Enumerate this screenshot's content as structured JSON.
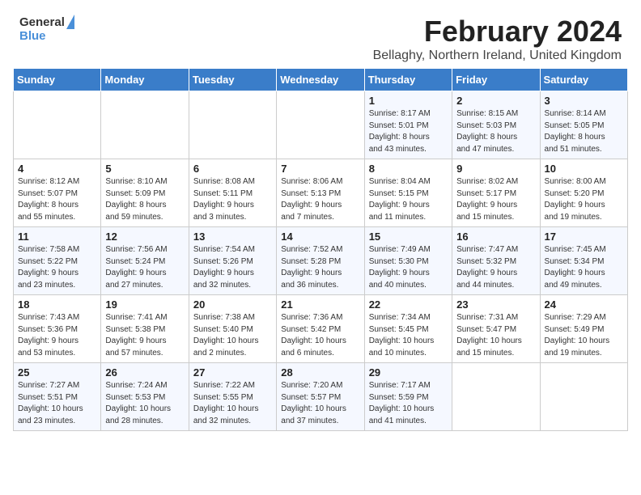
{
  "header": {
    "logo_general": "General",
    "logo_blue": "Blue",
    "title": "February 2024",
    "subtitle": "Bellaghy, Northern Ireland, United Kingdom"
  },
  "weekdays": [
    "Sunday",
    "Monday",
    "Tuesday",
    "Wednesday",
    "Thursday",
    "Friday",
    "Saturday"
  ],
  "weeks": [
    [
      {
        "day": "",
        "info": ""
      },
      {
        "day": "",
        "info": ""
      },
      {
        "day": "",
        "info": ""
      },
      {
        "day": "",
        "info": ""
      },
      {
        "day": "1",
        "info": "Sunrise: 8:17 AM\nSunset: 5:01 PM\nDaylight: 8 hours\nand 43 minutes."
      },
      {
        "day": "2",
        "info": "Sunrise: 8:15 AM\nSunset: 5:03 PM\nDaylight: 8 hours\nand 47 minutes."
      },
      {
        "day": "3",
        "info": "Sunrise: 8:14 AM\nSunset: 5:05 PM\nDaylight: 8 hours\nand 51 minutes."
      }
    ],
    [
      {
        "day": "4",
        "info": "Sunrise: 8:12 AM\nSunset: 5:07 PM\nDaylight: 8 hours\nand 55 minutes."
      },
      {
        "day": "5",
        "info": "Sunrise: 8:10 AM\nSunset: 5:09 PM\nDaylight: 8 hours\nand 59 minutes."
      },
      {
        "day": "6",
        "info": "Sunrise: 8:08 AM\nSunset: 5:11 PM\nDaylight: 9 hours\nand 3 minutes."
      },
      {
        "day": "7",
        "info": "Sunrise: 8:06 AM\nSunset: 5:13 PM\nDaylight: 9 hours\nand 7 minutes."
      },
      {
        "day": "8",
        "info": "Sunrise: 8:04 AM\nSunset: 5:15 PM\nDaylight: 9 hours\nand 11 minutes."
      },
      {
        "day": "9",
        "info": "Sunrise: 8:02 AM\nSunset: 5:17 PM\nDaylight: 9 hours\nand 15 minutes."
      },
      {
        "day": "10",
        "info": "Sunrise: 8:00 AM\nSunset: 5:20 PM\nDaylight: 9 hours\nand 19 minutes."
      }
    ],
    [
      {
        "day": "11",
        "info": "Sunrise: 7:58 AM\nSunset: 5:22 PM\nDaylight: 9 hours\nand 23 minutes."
      },
      {
        "day": "12",
        "info": "Sunrise: 7:56 AM\nSunset: 5:24 PM\nDaylight: 9 hours\nand 27 minutes."
      },
      {
        "day": "13",
        "info": "Sunrise: 7:54 AM\nSunset: 5:26 PM\nDaylight: 9 hours\nand 32 minutes."
      },
      {
        "day": "14",
        "info": "Sunrise: 7:52 AM\nSunset: 5:28 PM\nDaylight: 9 hours\nand 36 minutes."
      },
      {
        "day": "15",
        "info": "Sunrise: 7:49 AM\nSunset: 5:30 PM\nDaylight: 9 hours\nand 40 minutes."
      },
      {
        "day": "16",
        "info": "Sunrise: 7:47 AM\nSunset: 5:32 PM\nDaylight: 9 hours\nand 44 minutes."
      },
      {
        "day": "17",
        "info": "Sunrise: 7:45 AM\nSunset: 5:34 PM\nDaylight: 9 hours\nand 49 minutes."
      }
    ],
    [
      {
        "day": "18",
        "info": "Sunrise: 7:43 AM\nSunset: 5:36 PM\nDaylight: 9 hours\nand 53 minutes."
      },
      {
        "day": "19",
        "info": "Sunrise: 7:41 AM\nSunset: 5:38 PM\nDaylight: 9 hours\nand 57 minutes."
      },
      {
        "day": "20",
        "info": "Sunrise: 7:38 AM\nSunset: 5:40 PM\nDaylight: 10 hours\nand 2 minutes."
      },
      {
        "day": "21",
        "info": "Sunrise: 7:36 AM\nSunset: 5:42 PM\nDaylight: 10 hours\nand 6 minutes."
      },
      {
        "day": "22",
        "info": "Sunrise: 7:34 AM\nSunset: 5:45 PM\nDaylight: 10 hours\nand 10 minutes."
      },
      {
        "day": "23",
        "info": "Sunrise: 7:31 AM\nSunset: 5:47 PM\nDaylight: 10 hours\nand 15 minutes."
      },
      {
        "day": "24",
        "info": "Sunrise: 7:29 AM\nSunset: 5:49 PM\nDaylight: 10 hours\nand 19 minutes."
      }
    ],
    [
      {
        "day": "25",
        "info": "Sunrise: 7:27 AM\nSunset: 5:51 PM\nDaylight: 10 hours\nand 23 minutes."
      },
      {
        "day": "26",
        "info": "Sunrise: 7:24 AM\nSunset: 5:53 PM\nDaylight: 10 hours\nand 28 minutes."
      },
      {
        "day": "27",
        "info": "Sunrise: 7:22 AM\nSunset: 5:55 PM\nDaylight: 10 hours\nand 32 minutes."
      },
      {
        "day": "28",
        "info": "Sunrise: 7:20 AM\nSunset: 5:57 PM\nDaylight: 10 hours\nand 37 minutes."
      },
      {
        "day": "29",
        "info": "Sunrise: 7:17 AM\nSunset: 5:59 PM\nDaylight: 10 hours\nand 41 minutes."
      },
      {
        "day": "",
        "info": ""
      },
      {
        "day": "",
        "info": ""
      }
    ]
  ]
}
